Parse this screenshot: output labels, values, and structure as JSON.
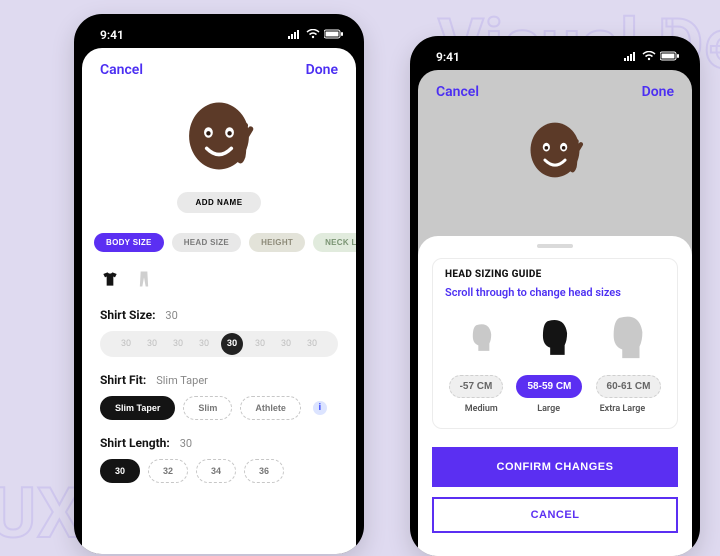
{
  "bg": {
    "top": "Visual Des",
    "bottom": "UX"
  },
  "status": {
    "time": "9:41"
  },
  "nav": {
    "cancel": "Cancel",
    "done": "Done"
  },
  "left": {
    "add_name": "ADD NAME",
    "tabs": [
      "BODY SIZE",
      "HEAD SIZE",
      "HEIGHT",
      "NECK LEN"
    ],
    "shirt_size": {
      "label": "Shirt Size:",
      "value": "30",
      "options": [
        "30",
        "30",
        "30",
        "30",
        "30",
        "30",
        "30",
        "30"
      ],
      "selected_index": 4
    },
    "shirt_fit": {
      "label": "Shirt Fit:",
      "value": "Slim Taper",
      "options": [
        "Slim Taper",
        "Slim",
        "Athlete"
      ],
      "selected_index": 0
    },
    "shirt_len": {
      "label": "Shirt Length:",
      "value": "30",
      "options": [
        "30",
        "32",
        "34",
        "36"
      ],
      "selected_index": 0
    }
  },
  "right": {
    "sheet_title": "HEAD SIZING GUIDE",
    "sheet_hint": "Scroll through to change head sizes",
    "sizes": [
      {
        "range": "-57 CM",
        "name": "Medium"
      },
      {
        "range": "58-59 CM",
        "name": "Large"
      },
      {
        "range": "60-61 CM",
        "name": "Extra Large"
      }
    ],
    "selected_index": 1,
    "confirm": "CONFIRM CHANGES",
    "cancel": "CANCEL"
  }
}
